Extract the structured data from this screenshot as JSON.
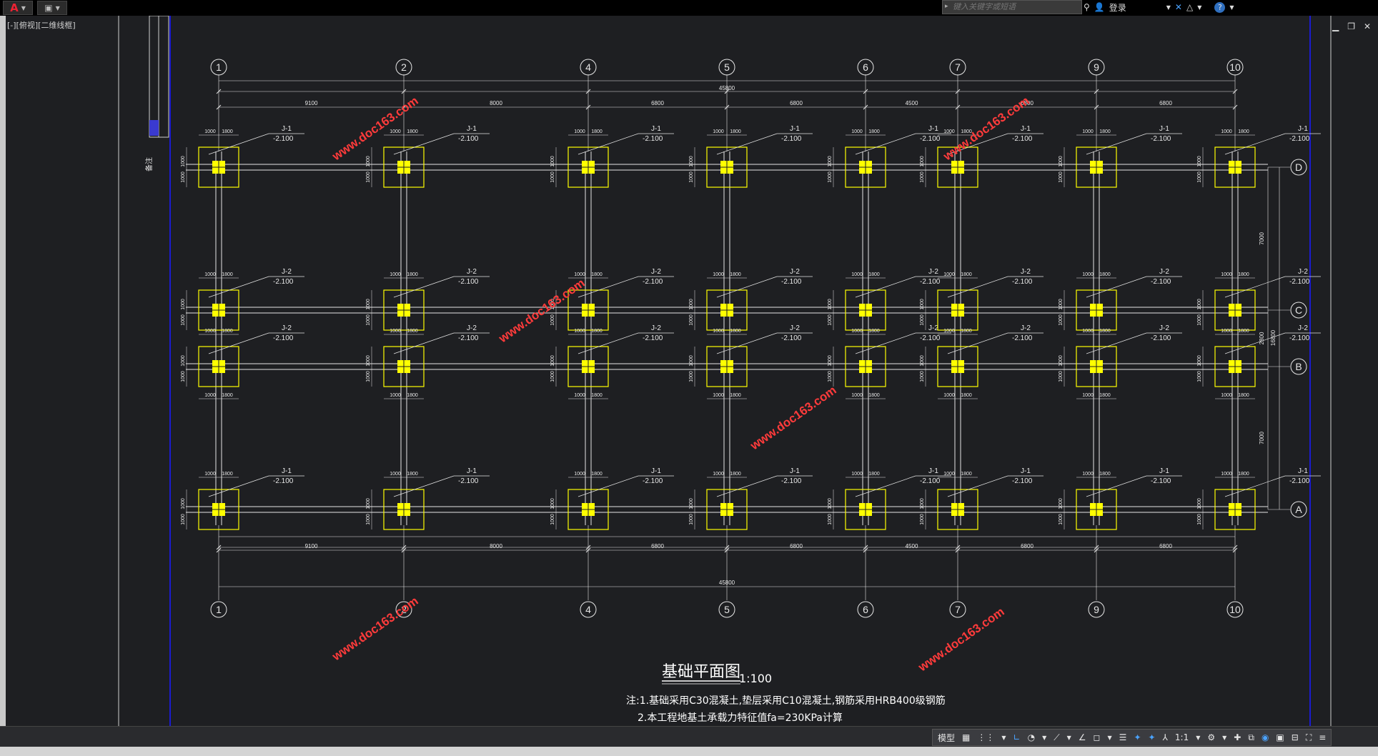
{
  "app": {
    "logo_label": "A",
    "viewport_label": "[-][俯视][二维线框]"
  },
  "search": {
    "placeholder": "键入关键字或短语"
  },
  "toolbar_right": {
    "login_label": "登录",
    "help_label": "?"
  },
  "drawing": {
    "title": "基础平面图",
    "scale": "1:100",
    "notes": [
      "注:1.基础采用C30混凝土,垫层采用C10混凝土,钢筋采用HRB400级钢筋",
      "2.本工程地基土承载力特征值fa=230KPa计算"
    ],
    "x_axes": [
      "1",
      "2",
      "4",
      "5",
      "6",
      "7",
      "9",
      "10"
    ],
    "y_axes": [
      "D",
      "C",
      "B",
      "A"
    ],
    "x_spans": [
      "9100",
      "8000",
      "6800",
      "6800",
      "4500",
      "6800",
      "6800"
    ],
    "total_length": "45800",
    "y_spans": [
      "7000",
      "2800",
      "7000"
    ],
    "total_width": "16800",
    "pad_dims": [
      "1000",
      "1800"
    ],
    "footing_labels": {
      "j1": "J-1",
      "j2": "J-2",
      "elevation": "-2.100"
    },
    "side_text": "备注",
    "watermark": "www.doc163.com"
  },
  "statusbar": {
    "model_label": "模型",
    "scale_label": "1:1"
  },
  "colors": {
    "background": "#1e1f22",
    "line": "#e6e6e6",
    "footing": "#ffff00",
    "watermark": "#ff3b3b",
    "border": "#1b1bd0"
  }
}
